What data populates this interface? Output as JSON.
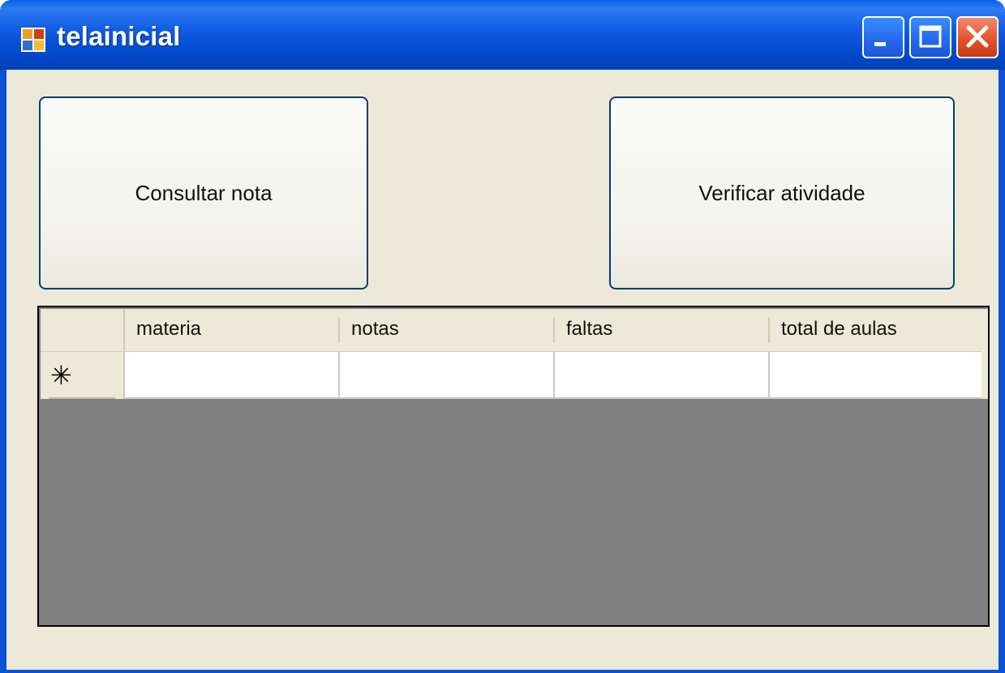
{
  "window": {
    "title": "telainicial",
    "controls": {
      "minimize_icon": "minimize-icon",
      "maximize_icon": "maximize-icon",
      "close_icon": "close-icon"
    }
  },
  "buttons": {
    "consultar": "Consultar nota",
    "verificar": "Verificar atividade"
  },
  "grid": {
    "columns": [
      "materia",
      "notas",
      "faltas",
      "total de aulas"
    ],
    "new_row_marker": "✳",
    "rows": [
      {
        "materia": "",
        "notas": "",
        "faltas": "",
        "total_de_aulas": ""
      }
    ]
  },
  "colors": {
    "titlebar": "#0054e3",
    "client_bg": "#ece9d8",
    "grid_bg": "#808080"
  }
}
